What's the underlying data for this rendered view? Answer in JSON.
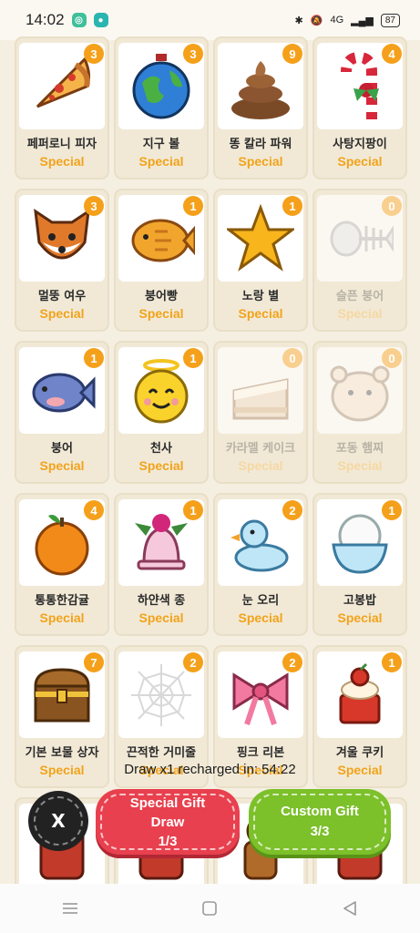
{
  "status": {
    "time": "14:02",
    "network": "4G",
    "battery": "87"
  },
  "cards": [
    {
      "name": "페퍼로니 피자",
      "type": "Special",
      "count": "3",
      "locked": false,
      "icon": "pizza-icon"
    },
    {
      "name": "지구 볼",
      "type": "Special",
      "count": "3",
      "locked": false,
      "icon": "earth-ornament-icon"
    },
    {
      "name": "똥 칼라 파워",
      "type": "Special",
      "count": "9",
      "locked": false,
      "icon": "poop-icon"
    },
    {
      "name": "사탕지팡이",
      "type": "Special",
      "count": "4",
      "locked": false,
      "icon": "candy-cane-icon"
    },
    {
      "name": "멀뚱 여우",
      "type": "Special",
      "count": "3",
      "locked": false,
      "icon": "fox-icon"
    },
    {
      "name": "붕어빵",
      "type": "Special",
      "count": "1",
      "locked": false,
      "icon": "fish-bread-icon"
    },
    {
      "name": "노랑 별",
      "type": "Special",
      "count": "1",
      "locked": false,
      "icon": "star-icon"
    },
    {
      "name": "슬픈 붕어",
      "type": "Special",
      "count": "0",
      "locked": true,
      "icon": "fish-bone-icon"
    },
    {
      "name": "붕어",
      "type": "Special",
      "count": "1",
      "locked": false,
      "icon": "fish-icon"
    },
    {
      "name": "천사",
      "type": "Special",
      "count": "1",
      "locked": false,
      "icon": "angel-face-icon"
    },
    {
      "name": "카라멜 케이크",
      "type": "Special",
      "count": "0",
      "locked": true,
      "icon": "cake-icon"
    },
    {
      "name": "포동 햄찌",
      "type": "Special",
      "count": "0",
      "locked": true,
      "icon": "hamster-icon"
    },
    {
      "name": "통통한감귤",
      "type": "Special",
      "count": "4",
      "locked": false,
      "icon": "tangerine-icon"
    },
    {
      "name": "하얀색 종",
      "type": "Special",
      "count": "1",
      "locked": false,
      "icon": "bell-icon"
    },
    {
      "name": "눈 오리",
      "type": "Special",
      "count": "2",
      "locked": false,
      "icon": "snow-duck-icon"
    },
    {
      "name": "고봉밥",
      "type": "Special",
      "count": "1",
      "locked": false,
      "icon": "rice-bowl-icon"
    },
    {
      "name": "기본 보물 상자",
      "type": "Special",
      "count": "7",
      "locked": false,
      "icon": "treasure-chest-icon"
    },
    {
      "name": "끈적한 거미줄",
      "type": "Special",
      "count": "2",
      "locked": false,
      "icon": "spider-web-icon"
    },
    {
      "name": "핑크 리본",
      "type": "Special",
      "count": "2",
      "locked": false,
      "icon": "pink-ribbon-icon"
    },
    {
      "name": "겨울 쿠키",
      "type": "Special",
      "count": "1",
      "locked": false,
      "icon": "winter-cookie-icon"
    },
    {
      "name": "",
      "type": "",
      "count": "",
      "locked": false,
      "icon": "partial-item-icon"
    },
    {
      "name": "",
      "type": "",
      "count": "",
      "locked": false,
      "icon": "partial-item-icon"
    },
    {
      "name": "",
      "type": "",
      "count": "",
      "locked": false,
      "icon": "gingerbread-icon"
    },
    {
      "name": "",
      "type": "",
      "count": "",
      "locked": false,
      "icon": "partial-item-icon"
    }
  ],
  "recharge_text": "Draw x1 recharged in: 54:22",
  "buttons": {
    "close_label": "X",
    "draw_line1": "Special Gift",
    "draw_line2": "Draw",
    "draw_count": "1/3",
    "custom_line1": "Custom Gift",
    "custom_count": "3/3"
  },
  "colors": {
    "accent_orange": "#f5a01a",
    "draw_red": "#e8404e",
    "custom_green": "#7cc02a"
  }
}
